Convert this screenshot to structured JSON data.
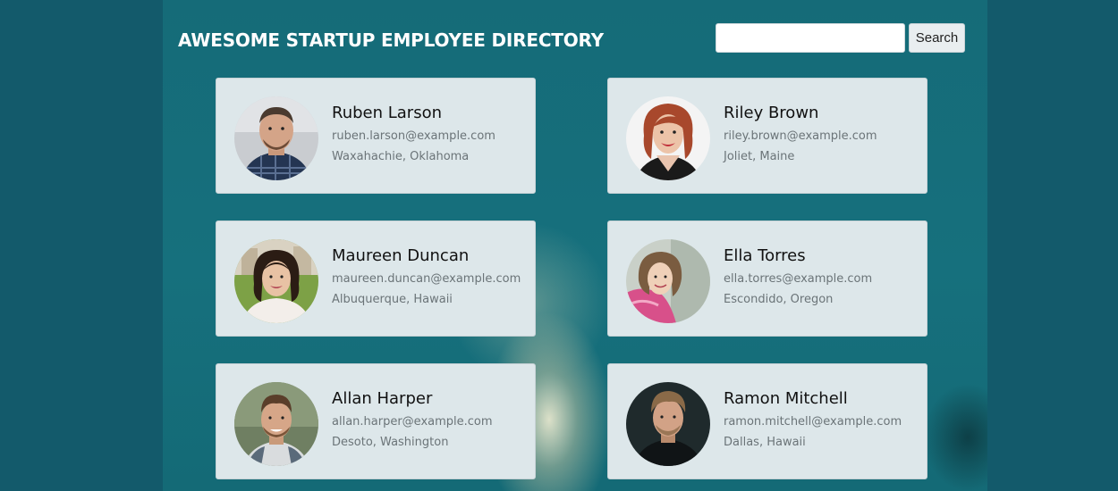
{
  "header": {
    "title": "AWESOME STARTUP EMPLOYEE DIRECTORY"
  },
  "search": {
    "placeholder": "",
    "value": "",
    "button_label": "Search"
  },
  "employees": [
    {
      "name": "Ruben Larson",
      "email": "ruben.larson@example.com",
      "location": "Waxahachie, Oklahoma",
      "avatar_icon": "portrait-man-plaid-shirt"
    },
    {
      "name": "Riley Brown",
      "email": "riley.brown@example.com",
      "location": "Joliet, Maine",
      "avatar_icon": "portrait-woman-red-hair"
    },
    {
      "name": "Maureen Duncan",
      "email": "maureen.duncan@example.com",
      "location": "Albuquerque, Hawaii",
      "avatar_icon": "portrait-woman-dark-hair"
    },
    {
      "name": "Ella Torres",
      "email": "ella.torres@example.com",
      "location": "Escondido, Oregon",
      "avatar_icon": "portrait-woman-pink-jacket"
    },
    {
      "name": "Allan Harper",
      "email": "allan.harper@example.com",
      "location": "Desoto, Washington",
      "avatar_icon": "portrait-man-smiling"
    },
    {
      "name": "Ramon Mitchell",
      "email": "ramon.mitchell@example.com",
      "location": "Dallas, Hawaii",
      "avatar_icon": "portrait-man-dark-background"
    }
  ],
  "colors": {
    "page_background": "#135a6b",
    "content_background": "#16707d",
    "card_background": "#dde7ea",
    "header_text": "#ffffff",
    "secondary_text": "#6b7478"
  }
}
